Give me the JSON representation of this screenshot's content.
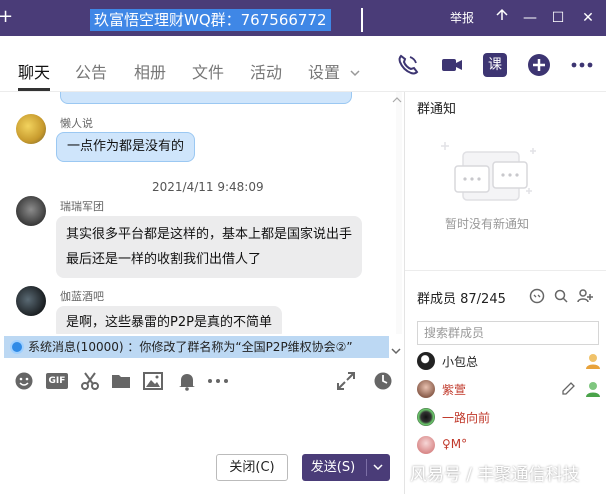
{
  "window": {
    "title": "玖富悟空理财WQ群：767566772",
    "controls": {
      "report": "举报",
      "minimize": "—",
      "maximize": "☐",
      "close": "✕"
    }
  },
  "tabs": [
    {
      "label": "聊天",
      "active": true
    },
    {
      "label": "公告"
    },
    {
      "label": "相册"
    },
    {
      "label": "文件"
    },
    {
      "label": "活动"
    },
    {
      "label": "设置",
      "has_dropdown": true
    }
  ],
  "toolbar_right_icons": [
    "phone-icon",
    "video-camera-icon",
    "class-icon",
    "add-app-icon",
    "more-icon"
  ],
  "class_icon_text": "课",
  "chat": {
    "messages": [
      {
        "sender": "懒人说",
        "text": "一点作为都是没有的",
        "style": "blue"
      },
      {
        "timestamp": "2021/4/11 9:48:09"
      },
      {
        "sender": "瑞瑞军团",
        "lines": [
          "其实很多平台都是这样的，基本上都是国家说出手",
          "最后还是一样的收割我们出借人了"
        ],
        "style": "gray"
      },
      {
        "sender": "伽蓝酒吧",
        "text": "是啊，这些暴雷的P2P是真的不简单",
        "style": "gray"
      }
    ],
    "system_message": "系统消息(10000) ：你修改了群名称为“全国P2P维权协会②”"
  },
  "input_toolbar_icons": [
    "emoji-icon",
    "gif-icon",
    "scissors-icon",
    "folder-icon",
    "image-icon",
    "bell-icon",
    "more-icon",
    "expand-icon",
    "history-icon"
  ],
  "gif_text": "GIF",
  "buttons": {
    "close": "关闭(C)",
    "send": "发送(S)"
  },
  "right_panel": {
    "notice_title": "群通知",
    "notice_empty": "暂时没有新通知",
    "members_title": "群成员 87/245",
    "member_search_placeholder": "搜索群成员",
    "members": [
      {
        "name": "小包总",
        "color": "#222222",
        "role": "admin"
      },
      {
        "name": "紫萱",
        "color": "#c0392b",
        "role": "admin",
        "editable": true
      },
      {
        "name": "一路向前",
        "color": "#c0392b"
      },
      {
        "name": "♀M°",
        "color": "#c0392b"
      }
    ]
  },
  "watermark": "风易号 / 丰聚通信科技",
  "colors": {
    "titlebar": "#4a3c78",
    "title_highlight": "#3f87e6",
    "bubble_blue": "#cfe5fb",
    "bubble_gray": "#ececed",
    "system_bar": "#bcd8f3",
    "send_button": "#4a3c78"
  }
}
